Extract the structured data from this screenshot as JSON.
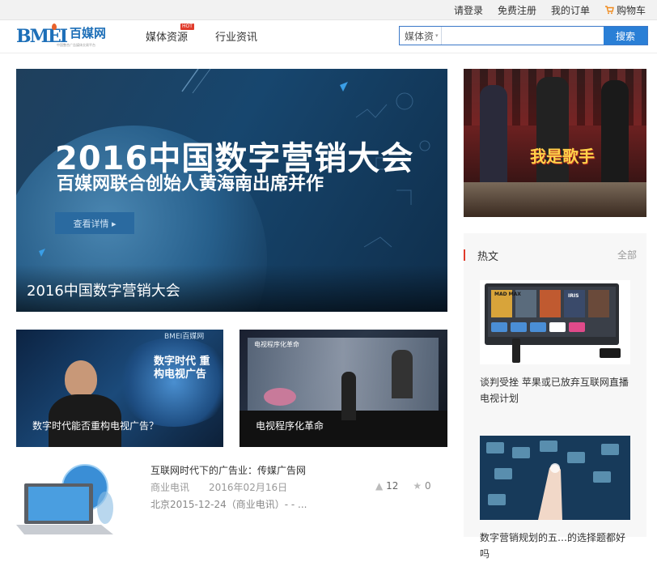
{
  "topbar": {
    "login": "请登录",
    "register": "免费注册",
    "orders": "我的订单",
    "cart": "购物车"
  },
  "logo": {
    "mark": "BMEI",
    "name": "百媒网",
    "tagline": "中国整合广告媒体交易平台"
  },
  "nav": {
    "items": [
      {
        "label": "媒体资源",
        "badge": "HOT"
      },
      {
        "label": "行业资讯"
      }
    ]
  },
  "search": {
    "category": "媒体资",
    "button": "搜索",
    "value": ""
  },
  "hero": {
    "headline": "2016中国数字营销大会",
    "subline": "百媒网联合创始人黄海南出席并作",
    "detail_button": "查看详情 ▸",
    "caption": "2016中国数字营销大会"
  },
  "cards": [
    {
      "caption": "数字时代能否重构电视广告？",
      "screen_text": "数字时代 重构电视广告",
      "logo": "BMEI百媒网"
    },
    {
      "caption": "电视程序化革命",
      "screen_text": "电视程序化革命"
    }
  ],
  "article": {
    "title": "互联网时代下的广告业：传媒广告网",
    "source": "商业电讯",
    "date": "2016年02月16日",
    "summary": "北京2015-12-24（商业电讯）- - ...",
    "likes": "12",
    "stars": "0"
  },
  "sidebar": {
    "banner_text": "我是歌手",
    "hot_title": "热文",
    "all_link": "全部",
    "posts": [
      {
        "title": "谈判受挫 苹果或已放弃互联网直播电视计划",
        "tv_apps": [
          "MAD MAX",
          "",
          "",
          "IRIS",
          ""
        ]
      },
      {
        "title": "数字营销规划的五…的选择题都好吗"
      }
    ]
  },
  "colors": {
    "accent": "#2a7fd6",
    "hot": "#e03b2b",
    "logo": "#1d6fb8"
  }
}
